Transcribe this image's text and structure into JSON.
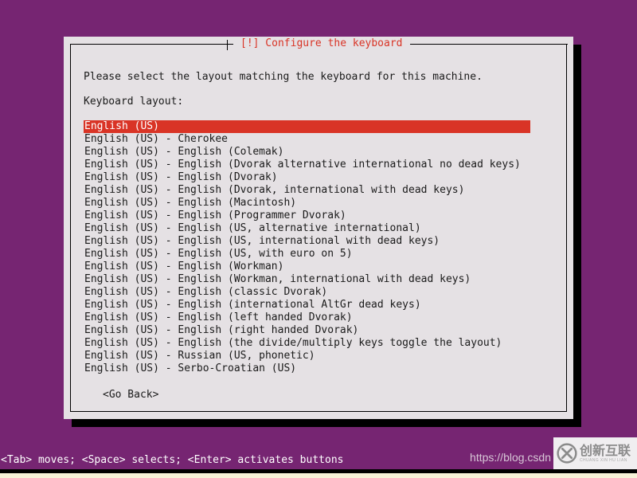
{
  "screen": {
    "background_color": "#762572",
    "accent_red": "#d93426",
    "dialog_background": "#e5e1e4"
  },
  "dialog": {
    "title": "[!] Configure the keyboard",
    "intro_text": "Please select the layout matching the keyboard for this machine.",
    "list_label": "Keyboard layout:",
    "go_back_label": "<Go Back>",
    "items": [
      {
        "label": "English (US)",
        "selected": true
      },
      {
        "label": "English (US) - Cherokee",
        "selected": false
      },
      {
        "label": "English (US) - English (Colemak)",
        "selected": false
      },
      {
        "label": "English (US) - English (Dvorak alternative international no dead keys)",
        "selected": false
      },
      {
        "label": "English (US) - English (Dvorak)",
        "selected": false
      },
      {
        "label": "English (US) - English (Dvorak, international with dead keys)",
        "selected": false
      },
      {
        "label": "English (US) - English (Macintosh)",
        "selected": false
      },
      {
        "label": "English (US) - English (Programmer Dvorak)",
        "selected": false
      },
      {
        "label": "English (US) - English (US, alternative international)",
        "selected": false
      },
      {
        "label": "English (US) - English (US, international with dead keys)",
        "selected": false
      },
      {
        "label": "English (US) - English (US, with euro on 5)",
        "selected": false
      },
      {
        "label": "English (US) - English (Workman)",
        "selected": false
      },
      {
        "label": "English (US) - English (Workman, international with dead keys)",
        "selected": false
      },
      {
        "label": "English (US) - English (classic Dvorak)",
        "selected": false
      },
      {
        "label": "English (US) - English (international AltGr dead keys)",
        "selected": false
      },
      {
        "label": "English (US) - English (left handed Dvorak)",
        "selected": false
      },
      {
        "label": "English (US) - English (right handed Dvorak)",
        "selected": false
      },
      {
        "label": "English (US) - English (the divide/multiply keys toggle the layout)",
        "selected": false
      },
      {
        "label": "English (US) - Russian (US, phonetic)",
        "selected": false
      },
      {
        "label": "English (US) - Serbo-Croatian (US)",
        "selected": false
      }
    ]
  },
  "status_bar": {
    "text": "<Tab> moves; <Space> selects; <Enter> activates buttons"
  },
  "watermark": {
    "url_text": "https://blog.csdn",
    "logo_chinese": "创新互联",
    "logo_pinyin": "CHUANG XIN HU LIAN"
  }
}
